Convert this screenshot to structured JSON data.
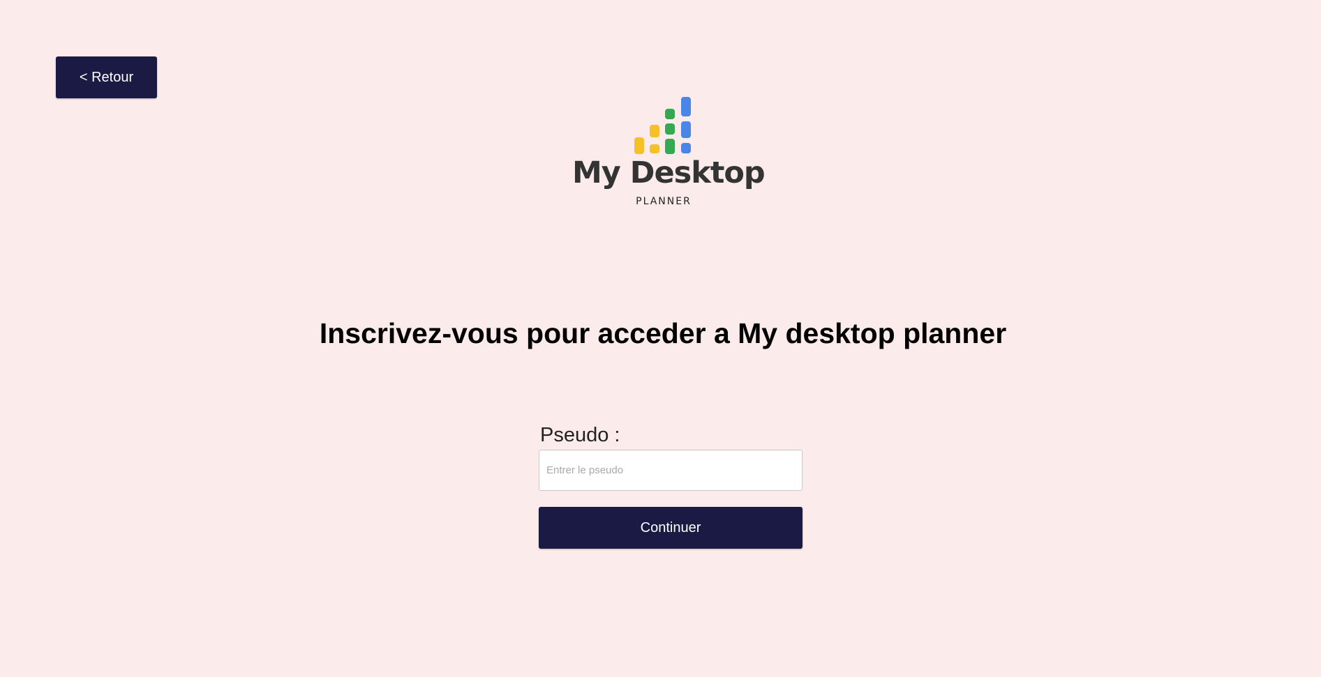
{
  "header": {
    "back_label": "< Retour"
  },
  "logo": {
    "title": "My Desktop",
    "subtitle": "PLANNER",
    "colors": {
      "yellow": "#f6c026",
      "green": "#34a853",
      "blue": "#4a86e8"
    }
  },
  "main": {
    "title": "Inscrivez-vous pour acceder a My desktop planner",
    "form": {
      "pseudo_label": "Pseudo :",
      "pseudo_placeholder": "Entrer le pseudo",
      "pseudo_value": "",
      "continue_label": "Continuer"
    }
  },
  "colors": {
    "background": "#fbeceb",
    "button": "#1b1a45",
    "button_text": "#ffffff"
  }
}
